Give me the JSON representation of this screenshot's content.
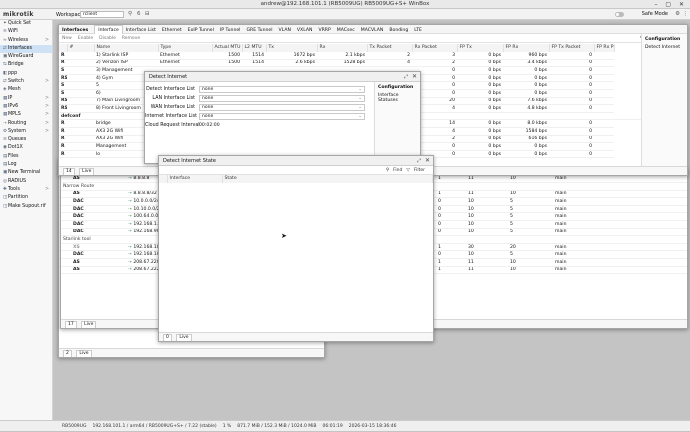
{
  "titlebar": {
    "text": "andrew@192.168.101.1 (RB5009UG) RB5009UG+S+ WinBox"
  },
  "toolbar": {
    "logo": "mikrotik",
    "workspace_label": "Workspace:",
    "workspace_value": "rclient",
    "count": "6",
    "safe_mode": "Safe Mode"
  },
  "sidebar": {
    "items": [
      {
        "icon": "✦",
        "label": "Quick Set",
        "arrow": ""
      },
      {
        "icon": "≋",
        "label": "WiFi",
        "arrow": ""
      },
      {
        "icon": "≈",
        "label": "Wireless",
        "arrow": ">"
      },
      {
        "icon": "⇄",
        "label": "Interfaces",
        "arrow": ""
      },
      {
        "icon": "▣",
        "label": "WireGuard",
        "arrow": ""
      },
      {
        "icon": "⇆",
        "label": "Bridge",
        "arrow": ""
      },
      {
        "icon": "◧",
        "label": "ppp",
        "arrow": ""
      },
      {
        "icon": "⇄",
        "label": "Switch",
        "arrow": ">"
      },
      {
        "icon": "◈",
        "label": "Mesh",
        "arrow": ""
      },
      {
        "icon": "▦",
        "label": "IP",
        "arrow": ">"
      },
      {
        "icon": "▦",
        "label": "IPv6",
        "arrow": ">"
      },
      {
        "icon": "▦",
        "label": "MPLS",
        "arrow": ">"
      },
      {
        "icon": "⇢",
        "label": "Routing",
        "arrow": ">"
      },
      {
        "icon": "⚙",
        "label": "System",
        "arrow": ">"
      },
      {
        "icon": "≡",
        "label": "Queues",
        "arrow": ""
      },
      {
        "icon": "◉",
        "label": "Dot1X",
        "arrow": ""
      },
      {
        "icon": "▤",
        "label": "Files",
        "arrow": ""
      },
      {
        "icon": "▤",
        "label": "Log",
        "arrow": ""
      },
      {
        "icon": "▣",
        "label": "New Terminal",
        "arrow": ""
      },
      {
        "icon": "◎",
        "label": "RADIUS",
        "arrow": ""
      },
      {
        "icon": "✚",
        "label": "Tools",
        "arrow": ">"
      },
      {
        "icon": "◫",
        "label": "Partition",
        "arrow": ""
      },
      {
        "icon": "◫",
        "label": "Make Supout.rif",
        "arrow": ""
      }
    ]
  },
  "interfaces": {
    "title": "Interfaces",
    "tabs": [
      "Interface",
      "Interface List",
      "Ethernet",
      "EoIP Tunnel",
      "IP Tunnel",
      "GRE Tunnel",
      "VLAN",
      "VXLAN",
      "VRRP",
      "MACsec",
      "MACVLAN",
      "Bonding",
      "LTE"
    ],
    "actions": [
      "New",
      "Enable",
      "Disable",
      "Remove"
    ],
    "find": "Find",
    "filter": "Filter",
    "columns": [
      "",
      "#",
      "Name",
      "Type",
      "Actual MTU",
      "L2 MTU",
      "Tx",
      "Rx",
      "Tx Packet",
      "Rx Packet",
      "FP Tx",
      "FP Rx",
      "FP Tx Packet",
      "FP Rx P"
    ],
    "rows": [
      [
        "R",
        "",
        "1) Starlink ISP",
        "Ethernet",
        "1500",
        "1514",
        "1672 bps",
        "2.1 kbps",
        "2",
        "3",
        "0 bps",
        "960 bps",
        "0",
        ""
      ],
      [
        "R",
        "",
        "2) Verizon ISP",
        "Ethernet",
        "1500",
        "1514",
        "2.6 kbps",
        "1528 bps",
        "4",
        "2",
        "0 bps",
        "3.4 kbps",
        "0",
        ""
      ],
      [
        "S",
        "",
        "3) Management",
        "",
        "",
        "",
        "",
        "",
        "",
        "0",
        "0 bps",
        "0 bps",
        "0",
        ""
      ],
      [
        "RS",
        "",
        "4) Gym",
        "",
        "",
        "",
        "",
        "",
        "",
        "0",
        "0 bps",
        "0 bps",
        "0",
        ""
      ],
      [
        "S",
        "",
        "5",
        "",
        "",
        "",
        "",
        "",
        "",
        "0",
        "0 bps",
        "0 bps",
        "0",
        ""
      ],
      [
        "S",
        "",
        "6)",
        "",
        "",
        "",
        "",
        "",
        "",
        "0",
        "0 bps",
        "0 bps",
        "0",
        ""
      ],
      [
        "RS",
        "",
        "7) Main Livingroom",
        "",
        "",
        "",
        "",
        "",
        "",
        "20",
        "0 bps",
        "7.6 kbps",
        "0",
        ""
      ],
      [
        "RS",
        "",
        "8) Front Livingroom",
        "",
        "",
        "",
        "",
        "",
        "",
        "4",
        "0 bps",
        "4.8 kbps",
        "0",
        ""
      ],
      [
        "defconf",
        "",
        "",
        "",
        "",
        "",
        "",
        "",
        "",
        "",
        "",
        "",
        "",
        ""
      ],
      [
        "R",
        "",
        "bridge",
        "",
        "",
        "",
        "",
        "",
        "",
        "14",
        "0 bps",
        "8.0 kbps",
        "0",
        ""
      ],
      [
        "R",
        "",
        "AX3 2G Wifi",
        "",
        "",
        "",
        "",
        "",
        "",
        "4",
        "0 bps",
        "1584 bps",
        "0",
        ""
      ],
      [
        "R",
        "",
        "AX3 2G Wifi",
        "",
        "",
        "",
        "",
        "",
        "",
        "2",
        "0 bps",
        "616 bps",
        "0",
        ""
      ],
      [
        "R",
        "",
        "Management",
        "",
        "",
        "",
        "",
        "",
        "",
        "0",
        "0 bps",
        "0 bps",
        "0",
        ""
      ],
      [
        "R",
        "",
        "lo",
        "",
        "",
        "",
        "",
        "",
        "",
        "0",
        "0 bps",
        "0 bps",
        "0",
        ""
      ]
    ],
    "count": "14",
    "live": "Live",
    "side_title": "Configuration",
    "side_item": "Detect Internet"
  },
  "detect": {
    "title": "Detect Internet",
    "fields": [
      {
        "label": "Detect Interface List",
        "value": "none"
      },
      {
        "label": "LAN Interface List",
        "value": "none"
      },
      {
        "label": "WAN Interface List",
        "value": "none"
      },
      {
        "label": "Internet Interface List",
        "value": "none"
      },
      {
        "label": "Cloud Request Interval",
        "value": "00:02:00"
      }
    ],
    "side_title": "Configuration",
    "side_item": "Interface Statuses"
  },
  "routes": {
    "groups": [
      {
        "label": "",
        "rows": [
          [
            "AS",
            "8.8.8.8",
            "",
            "1",
            "11",
            "10",
            "main"
          ]
        ]
      },
      {
        "label": "Narrow Route",
        "rows": [
          [
            "AS",
            "8.8.8.8/32",
            "",
            "1",
            "11",
            "10",
            "main"
          ],
          [
            "DAC",
            "10.0.0.0/24",
            "",
            "0",
            "10",
            "5",
            "main"
          ],
          [
            "DAC",
            "10.10.0.0/24",
            "",
            "0",
            "10",
            "5",
            "main"
          ],
          [
            "DAC",
            "100.64.0.0/10",
            "",
            "0",
            "10",
            "5",
            "main"
          ],
          [
            "DAC",
            "192.168.1.0/24",
            "",
            "0",
            "10",
            "5",
            "main"
          ],
          [
            "DAC",
            "192.168.90.0/24",
            "",
            "0",
            "10",
            "5",
            "main"
          ]
        ]
      },
      {
        "label": "Starlink tool",
        "rows": [
          [
            "XS",
            "192.168.100.1",
            "",
            "1",
            "30",
            "20",
            "main"
          ],
          [
            "DAC",
            "192.168.101.0/24",
            "",
            "0",
            "10",
            "5",
            "main"
          ],
          [
            "AS",
            "208.67.220.220",
            "",
            "1",
            "11",
            "10",
            "main"
          ],
          [
            "AS",
            "208.67.222.222",
            "",
            "1",
            "11",
            "10",
            "main"
          ]
        ]
      }
    ],
    "count": "17",
    "live": "Live"
  },
  "back": {
    "count": "2",
    "live": "Live"
  },
  "state": {
    "title": "Detect Internet State",
    "find": "Find",
    "filter": "Filter",
    "columns": [
      "",
      "Interface",
      "State"
    ],
    "count": "0",
    "live": "Live"
  },
  "statusbar": {
    "items": [
      "RB5009UG",
      "192.168.101.1 / arm64 / RB5009UG+S+ / 7.22 (stable)",
      "1 %",
      "871.7 MiB / 152.3 MiB / 1024.0 MiB",
      "06:01:19",
      "2026-03-15 18:36:46"
    ]
  }
}
